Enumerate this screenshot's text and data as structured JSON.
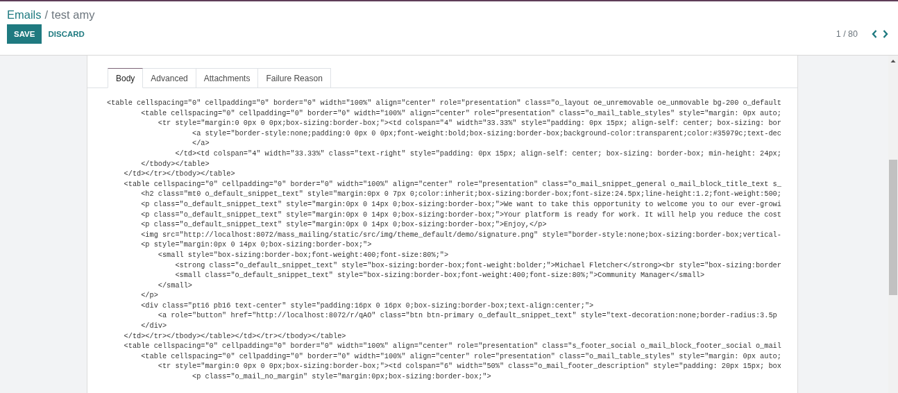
{
  "breadcrumb": {
    "parent": "Emails",
    "separator": "/",
    "current": "test amy"
  },
  "buttons": [
    {
      "label": "SAVE",
      "kind": "primary"
    },
    {
      "label": "DISCARD",
      "kind": "link"
    }
  ],
  "pager": {
    "text": "1 / 80"
  },
  "tabs": [
    {
      "label": "Body",
      "selected": true
    },
    {
      "label": "Advanced",
      "selected": false
    },
    {
      "label": "Attachments",
      "selected": false
    },
    {
      "label": "Failure Reason",
      "selected": false
    }
  ],
  "code_lines": [
    "<table cellspacing=\"0\" cellpadding=\"0\" border=\"0\" width=\"100%\" align=\"center\" role=\"presentation\" class=\"o_layout oe_unremovable oe_unmovable bg-200 o_default",
    "        <table cellspacing=\"0\" cellpadding=\"0\" border=\"0\" width=\"100%\" align=\"center\" role=\"presentation\" class=\"o_mail_table_styles\" style=\"margin: 0px auto;",
    "            <tr style=\"margin:0 0px 0 0px;box-sizing:border-box;\"><td colspan=\"4\" width=\"33.33%\" style=\"padding: 0px 15px; align-self: center; box-sizing: bor",
    "                    <a style=\"border-style:none;padding:0 0px 0 0px;font-weight:bold;box-sizing:border-box;background-color:transparent;color:#35979c;text-dec",
    "                    </a>",
    "                </td><td colspan=\"4\" width=\"33.33%\" class=\"text-right\" style=\"padding: 0px 15px; align-self: center; box-sizing: border-box; min-height: 24px;",
    "        </tbody></table>",
    "    </td></tr></tbody></table>",
    "    <table cellspacing=\"0\" cellpadding=\"0\" border=\"0\" width=\"100%\" align=\"center\" role=\"presentation\" class=\"o_mail_snippet_general o_mail_block_title_text s_",
    "        <h2 class=\"mt0 o_default_snippet_text\" style=\"margin:0px 0 7px 0;color:inherit;box-sizing:border-box;font-size:24.5px;line-height:1.2;font-weight:500;",
    "        <p class=\"o_default_snippet_text\" style=\"margin:0px 0 14px 0;box-sizing:border-box;\">We want to take this opportunity to welcome you to our ever-growi",
    "        <p class=\"o_default_snippet_text\" style=\"margin:0px 0 14px 0;box-sizing:border-box;\">Your platform is ready for work. It will help you reduce the cost",
    "        <p class=\"o_default_snippet_text\" style=\"margin:0px 0 14px 0;box-sizing:border-box;\">Enjoy,</p>",
    "        <img src=\"http://localhost:8072/mass_mailing/static/src/img/theme_default/demo/signature.png\" style=\"border-style:none;box-sizing:border-box;vertical-",
    "        <p style=\"margin:0px 0 14px 0;box-sizing:border-box;\">",
    "            <small style=\"box-sizing:border-box;font-weight:400;font-size:80%;\">",
    "                <strong class=\"o_default_snippet_text\" style=\"box-sizing:border-box;font-weight:bolder;\">Michael Fletcher</strong><br style=\"box-sizing:border",
    "                <small class=\"o_default_snippet_text\" style=\"box-sizing:border-box;font-weight:400;font-size:80%;\">Community Manager</small>",
    "            </small>",
    "        </p>",
    "        <div class=\"pt16 pb16 text-center\" style=\"padding:16px 0 16px 0;box-sizing:border-box;text-align:center;\">",
    "            <a role=\"button\" href=\"http://localhost:8072/r/qAO\" class=\"btn btn-primary o_default_snippet_text\" style=\"text-decoration:none;border-radius:3.5p",
    "        </div>",
    "    </td></tr></tbody></table></td></tr></tbody></table>",
    "    <table cellspacing=\"0\" cellpadding=\"0\" border=\"0\" width=\"100%\" align=\"center\" role=\"presentation\" class=\"s_footer_social o_mail_block_footer_social o_mail",
    "        <table cellspacing=\"0\" cellpadding=\"0\" border=\"0\" width=\"100%\" align=\"center\" role=\"presentation\" class=\"o_mail_table_styles\" style=\"margin: 0px auto;",
    "            <tr style=\"margin:0 0px 0 0px;box-sizing:border-box;\"><td colspan=\"6\" width=\"50%\" class=\"o_mail_footer_description\" style=\"padding: 20px 15px; box",
    "                    <p class=\"o_mail_no_margin\" style=\"margin:0px;box-sizing:border-box;\">"
  ]
}
